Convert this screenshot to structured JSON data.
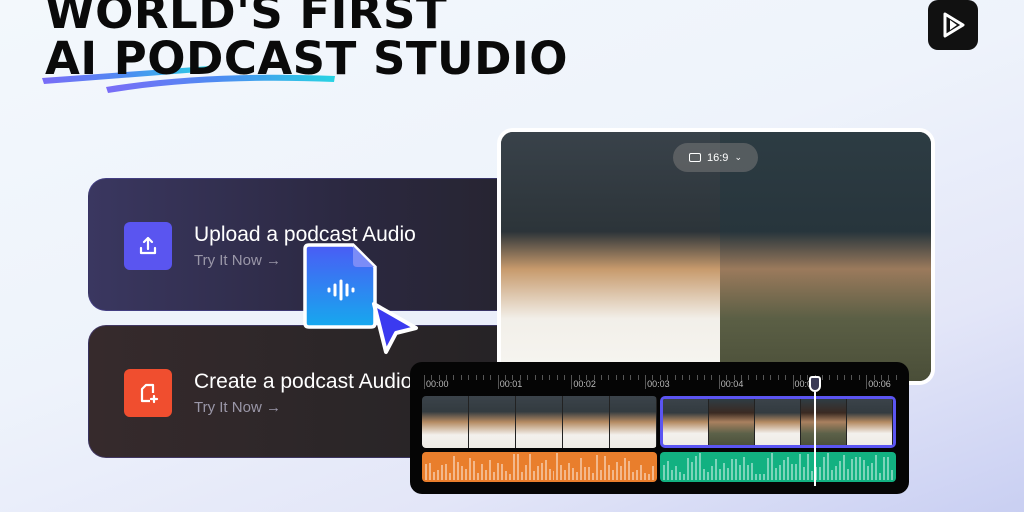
{
  "headline": {
    "line1": "WORLD'S FIRST",
    "line2": "AI PODCAST STUDIO"
  },
  "logo": {
    "icon": "play-logo-icon"
  },
  "cards": [
    {
      "title": "Upload a podcast Audio",
      "cta": "Try It Now →",
      "icon": "upload-icon",
      "color": "#5a55f0"
    },
    {
      "title": "Create a podcast Audio",
      "cta": "Try It Now →",
      "icon": "create-file-icon",
      "color": "#f04e2f"
    }
  ],
  "preview": {
    "aspect_ratio": "16:9"
  },
  "timeline": {
    "labels": [
      "00:00",
      "00:01",
      "00:02",
      "00:03",
      "00:04",
      "00:05",
      "00:06"
    ],
    "playhead_seconds": 5.3,
    "clip1_color": "#e97e2c",
    "clip2_color": "#12b181",
    "selected_border": "#5b55f2"
  }
}
